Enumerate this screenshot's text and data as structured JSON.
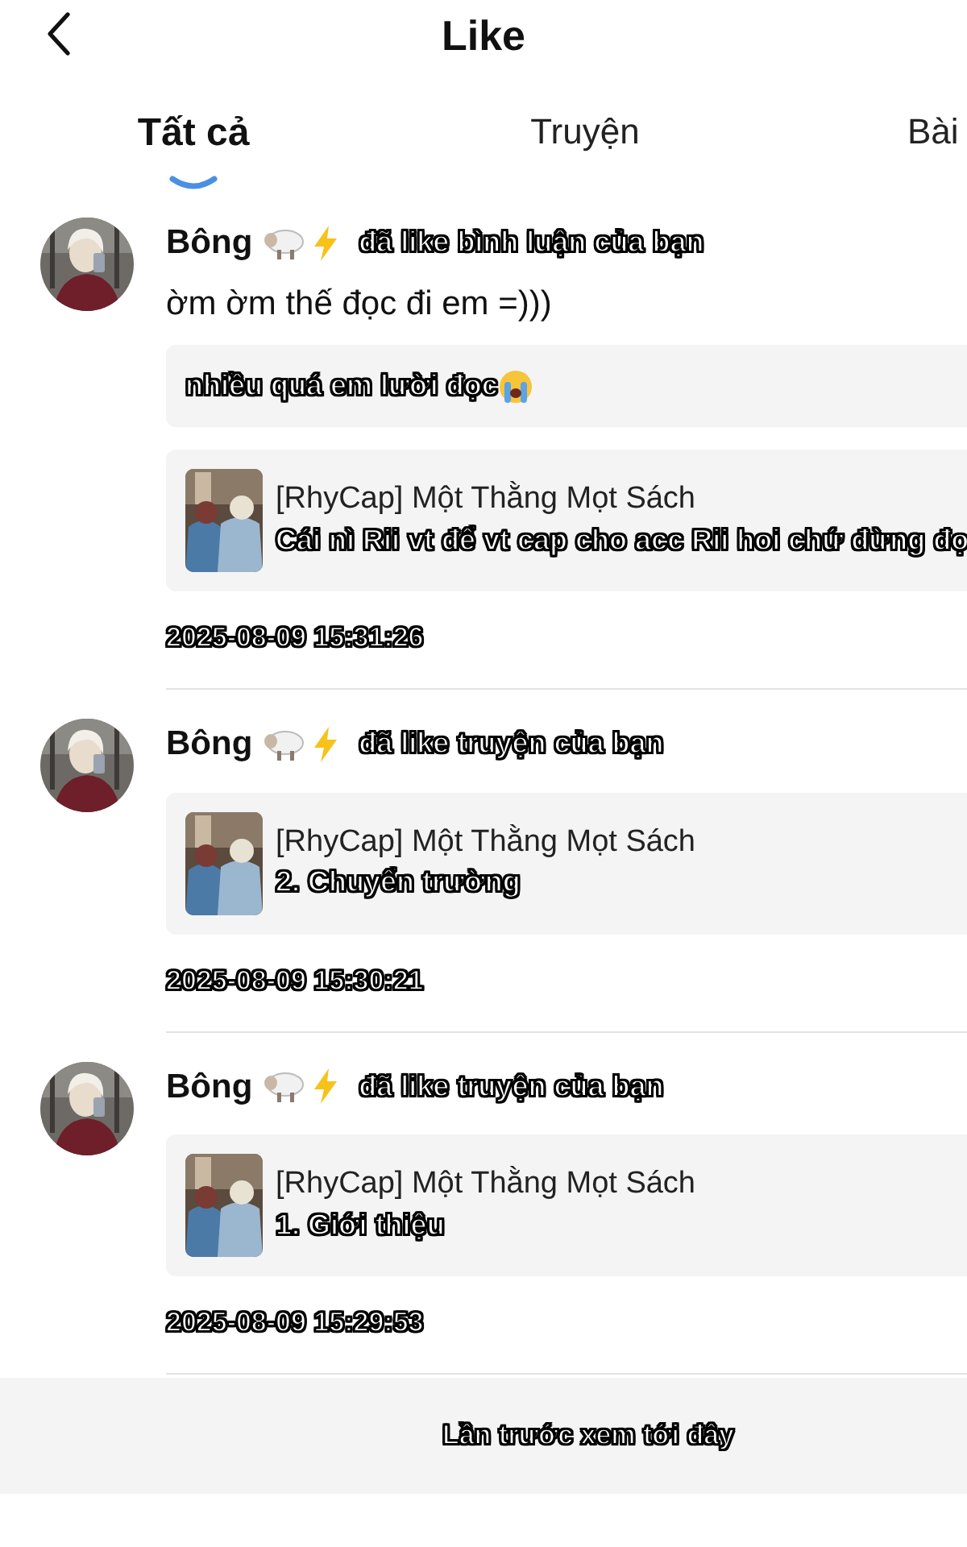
{
  "header": {
    "title": "Like"
  },
  "tabs": [
    {
      "label": "Tất cả",
      "selected": true
    },
    {
      "label": "Truyện",
      "selected": false
    },
    {
      "label": "Bài",
      "selected": false
    }
  ],
  "notifications": [
    {
      "user": "Bông",
      "action": "đã like bình luận của bạn",
      "comment": "ờm ờm thế đọc đi em =)))",
      "reply": "nhiều quá em lười đọc",
      "story": {
        "title": "[RhyCap] Một Thằng Mọt Sách",
        "detail": "Cái nì Rii vt để vt cap cho acc Rii hoi chứ đừng đọ"
      },
      "time": "2025-08-09 15:31:26"
    },
    {
      "user": "Bông",
      "action": "đã like truyện của bạn",
      "story": {
        "title": "[RhyCap] Một Thằng Mọt Sách",
        "detail": "2. Chuyển trường"
      },
      "time": "2025-08-09 15:30:21"
    },
    {
      "user": "Bông",
      "action": "đã like truyện của bạn",
      "story": {
        "title": "[RhyCap] Một Thằng Mọt Sách",
        "detail": "1. Giới thiệu"
      },
      "time": "2025-08-09 15:29:53"
    }
  ],
  "footer": {
    "text": "Lần trước xem tới đây"
  }
}
